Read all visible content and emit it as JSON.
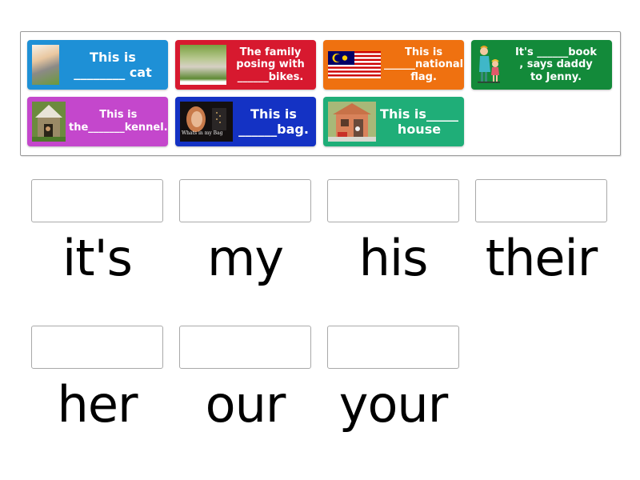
{
  "activity": "match-up",
  "cards": [
    {
      "id": "cat",
      "text": "This is\n________ cat",
      "color": "#1e90d6",
      "image": "boy-with-cat-photo"
    },
    {
      "id": "bikes",
      "text": "The family\nposing with\n______bikes.",
      "color": "#d7192f",
      "image": "family-on-bikes-photo"
    },
    {
      "id": "flag",
      "text": "This is\n______national\nflag.",
      "color": "#ef7110",
      "image": "malaysia-flag"
    },
    {
      "id": "book",
      "text": "It's ______book\n, says daddy\nto Jenny.",
      "color": "#138a3a",
      "image": "daddy-and-jenny-cartoon"
    },
    {
      "id": "kennel",
      "text": "This is\nthe_______kennel.",
      "color": "#c447cc",
      "image": "dog-kennel-photo"
    },
    {
      "id": "bag",
      "text": "This is\n______bag.",
      "color": "#1432c4",
      "image": "whats-in-my-bag-photo",
      "caption": "Whats in my Bag"
    },
    {
      "id": "house",
      "text": "This is_____\nhouse",
      "color": "#1fae78",
      "image": "playhouse-photo"
    }
  ],
  "answers": [
    "it's",
    "my",
    "his",
    "their",
    "her",
    "our",
    "your"
  ]
}
